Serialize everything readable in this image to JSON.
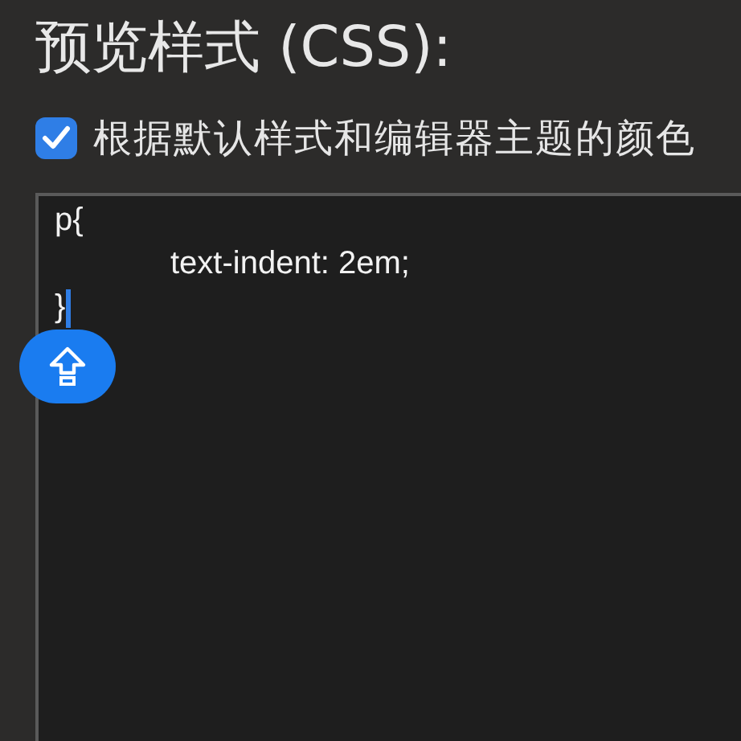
{
  "title": "预览样式 (CSS):",
  "checkbox": {
    "label": "根据默认样式和编辑器主题的颜色",
    "checked": true
  },
  "editor": {
    "lines": [
      "p{",
      "\ttext-indent: 2em;",
      "}"
    ]
  },
  "caps_lock": {
    "on": true
  }
}
